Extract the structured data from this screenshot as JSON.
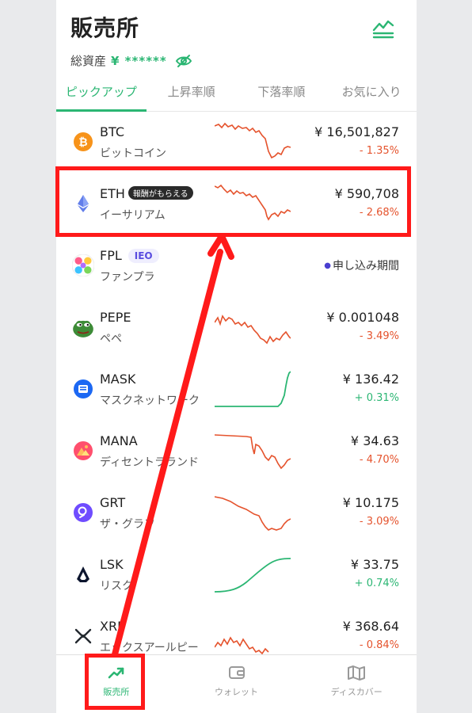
{
  "header": {
    "title": "販売所",
    "assets_label": "総資産",
    "assets_value": "¥ ******"
  },
  "tabs": [
    "ピックアップ",
    "上昇率順",
    "下落率順",
    "お気に入り"
  ],
  "coins": [
    {
      "symbol": "BTC",
      "name": "ビットコイン",
      "price": "¥ 16,501,827",
      "change": "- 1.35%",
      "direction": "down",
      "icon": "bitcoin-icon",
      "color": "#f7931a"
    },
    {
      "symbol": "ETH",
      "badge": "報酬がもらえる",
      "name": "イーサリアム",
      "price": "¥ 590,708",
      "change": "- 2.68%",
      "direction": "down",
      "icon": "ethereum-icon",
      "color": "#627eea"
    },
    {
      "symbol": "FPL",
      "badge": "IEO",
      "name": "ファンプラ",
      "status": "申し込み期間",
      "icon": "fpl-icon"
    },
    {
      "symbol": "PEPE",
      "name": "ペペ",
      "price": "¥ 0.001048",
      "change": "- 3.49%",
      "direction": "down",
      "icon": "pepe-icon",
      "color": "#3d8b37"
    },
    {
      "symbol": "MASK",
      "name": "マスクネットワーク",
      "price": "¥ 136.42",
      "change": "+ 0.31%",
      "direction": "up",
      "icon": "mask-icon",
      "color": "#1c68f3"
    },
    {
      "symbol": "MANA",
      "name": "ディセントラランド",
      "price": "¥ 34.63",
      "change": "- 4.70%",
      "direction": "down",
      "icon": "decentraland-icon",
      "color": "#ff2d55"
    },
    {
      "symbol": "GRT",
      "name": "ザ・グラフ",
      "price": "¥ 10.175",
      "change": "- 3.09%",
      "direction": "down",
      "icon": "graph-icon",
      "color": "#6f4cff"
    },
    {
      "symbol": "LSK",
      "name": "リスク",
      "price": "¥ 33.75",
      "change": "+ 0.74%",
      "direction": "up",
      "icon": "lisk-icon",
      "color": "#0c152e"
    },
    {
      "symbol": "XRP",
      "name": "エックスアールピー",
      "price": "¥ 368.64",
      "change": "- 0.84%",
      "direction": "down",
      "icon": "xrp-icon",
      "color": "#23292f"
    }
  ],
  "nav": [
    "販売所",
    "ウォレット",
    "ディスカバー"
  ],
  "colors": {
    "accent": "#2bb673",
    "down": "#e5532d",
    "up": "#2bb673",
    "annotation": "#ff1a1a"
  }
}
